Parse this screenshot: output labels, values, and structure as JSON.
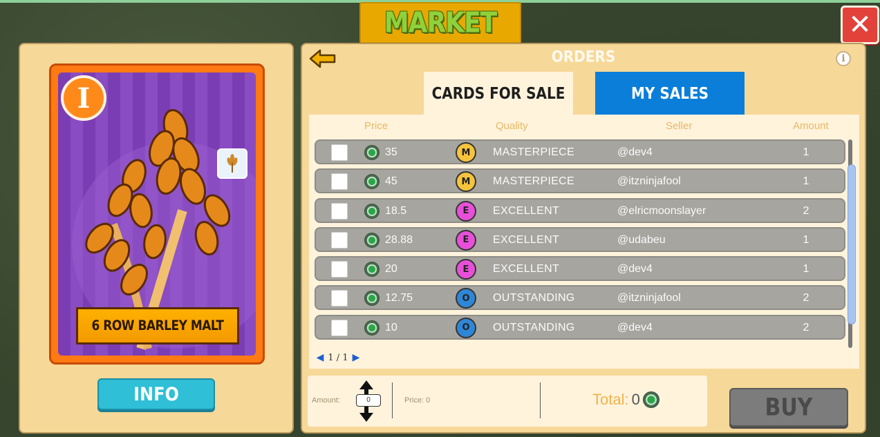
{
  "header": {
    "title": "MARKET",
    "close_icon": "close-icon"
  },
  "card": {
    "tier": "I",
    "name": "6 ROW BARLEY MALT",
    "type_icon": "wheat-icon",
    "info_label": "INFO"
  },
  "orders": {
    "title": "ORDERS",
    "back_icon": "back-arrow-icon",
    "info_icon": "info-icon",
    "info_glyph": "i",
    "tabs": [
      {
        "label": "CARDS FOR SALE",
        "active": true
      },
      {
        "label": "MY SALES",
        "active": false
      }
    ],
    "columns": {
      "price": "Price",
      "quality": "Quality",
      "seller": "Seller",
      "amount": "Amount"
    },
    "rows": [
      {
        "price": "35",
        "badge": "M",
        "quality": "MASTERPIECE",
        "seller": "@dev4",
        "amount": "1"
      },
      {
        "price": "45",
        "badge": "M",
        "quality": "MASTERPIECE",
        "seller": "@itzninjafool",
        "amount": "1"
      },
      {
        "price": "18.5",
        "badge": "E",
        "quality": "EXCELLENT",
        "seller": "@elricmoonslayer",
        "amount": "2"
      },
      {
        "price": "28.88",
        "badge": "E",
        "quality": "EXCELLENT",
        "seller": "@udabeu",
        "amount": "1"
      },
      {
        "price": "20",
        "badge": "E",
        "quality": "EXCELLENT",
        "seller": "@dev4",
        "amount": "1"
      },
      {
        "price": "12.75",
        "badge": "O",
        "quality": "OUTSTANDING",
        "seller": "@itzninjafool",
        "amount": "2"
      },
      {
        "price": "10",
        "badge": "O",
        "quality": "OUTSTANDING",
        "seller": "@dev4",
        "amount": "2"
      }
    ],
    "pager": "1 / 1",
    "pager_prev": "◀",
    "pager_next": "▶"
  },
  "purchase": {
    "amount_label": "Amount:",
    "amount_value": "0",
    "price_label": "Price: 0",
    "total_label": "Total:",
    "total_value": "0",
    "buy_label": "BUY"
  },
  "colors": {
    "masterpiece": "#f5c43c",
    "excellent": "#e84fd8",
    "outstanding": "#2e86d6",
    "accent": "#e9a800",
    "my_sales_tab": "#0a7ed9"
  }
}
